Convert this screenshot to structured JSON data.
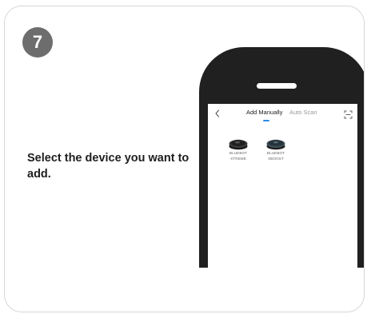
{
  "step": {
    "number": "7"
  },
  "instruction": {
    "text": "Select the device you want to add."
  },
  "app": {
    "tabs": [
      {
        "label": "Add Manually",
        "active": true
      },
      {
        "label": "Auto Scan",
        "active": false
      }
    ],
    "icons": {
      "back": "chevron-left-icon",
      "scan": "scan-frame-icon"
    },
    "accent_color": "#2b8be6",
    "devices": [
      {
        "line1": "BLUEBOT",
        "line2": "XTREME"
      },
      {
        "line1": "BLUEBOT",
        "line2": "XBOOST"
      }
    ]
  },
  "colors": {
    "badge": "#6d6d6d",
    "phone_body": "#202020",
    "card_border": "#d6d6d6"
  }
}
